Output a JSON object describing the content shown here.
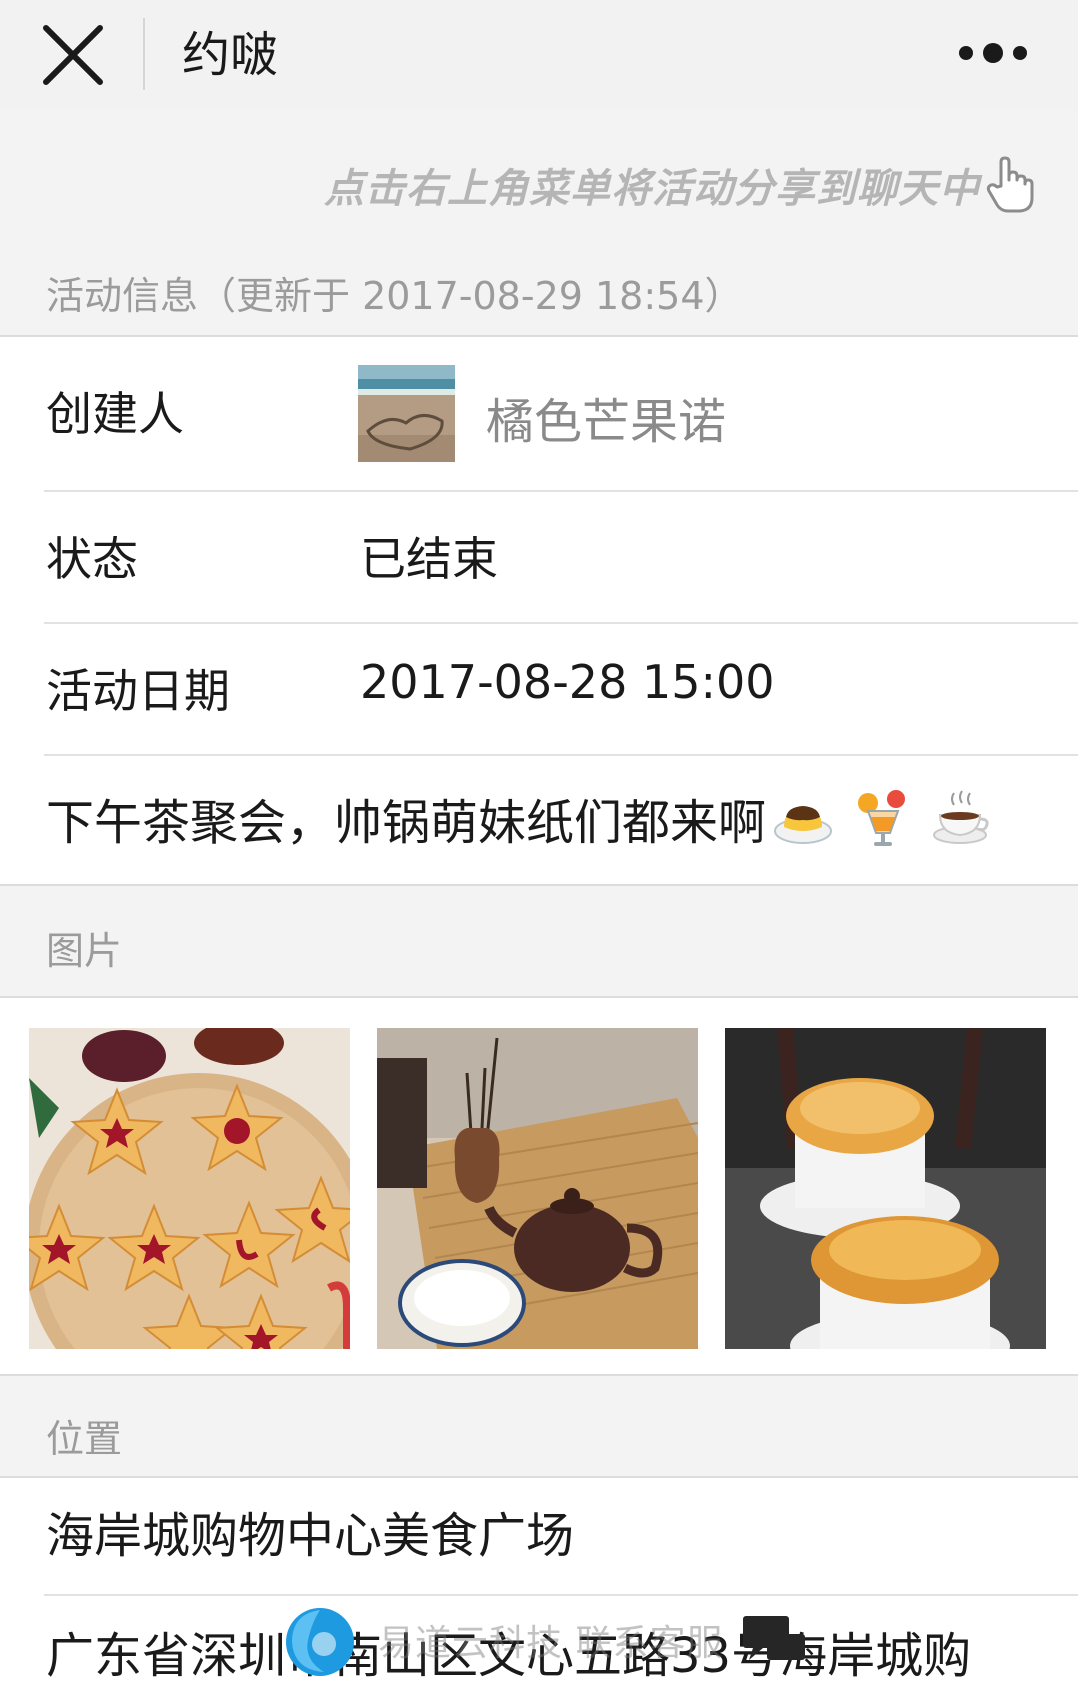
{
  "nav": {
    "title": "约啵"
  },
  "hint": {
    "text": "点击右上角菜单将活动分享到聊天中"
  },
  "info_section": {
    "header": "活动信息（更新于 2017-08-29 18:54）"
  },
  "info": {
    "creator_label": "创建人",
    "creator_name": "橘色芒果诺",
    "status_label": "状态",
    "status_value": "已结束",
    "date_label": "活动日期",
    "date_value": "2017-08-28 15:00",
    "description": "下午茶聚会，帅锅萌妹纸们都来啊"
  },
  "photos_section": {
    "header": "图片"
  },
  "location_section": {
    "header": "位置"
  },
  "location": {
    "name": "海岸城购物中心美食广场",
    "address": "广东省深圳市南山区文心五路33号海岸城购"
  },
  "overlay": {
    "text": "易道云科技 联系客服"
  },
  "icons": {
    "close": "close-icon",
    "more": "more-dots-icon",
    "hand": "pointing-hand-icon"
  },
  "colors": {
    "page_bg": "#f3f3f3",
    "section_text": "#9b9b9b",
    "hint_text": "#b5b5b5",
    "creator_name": "#8a8a8a"
  }
}
